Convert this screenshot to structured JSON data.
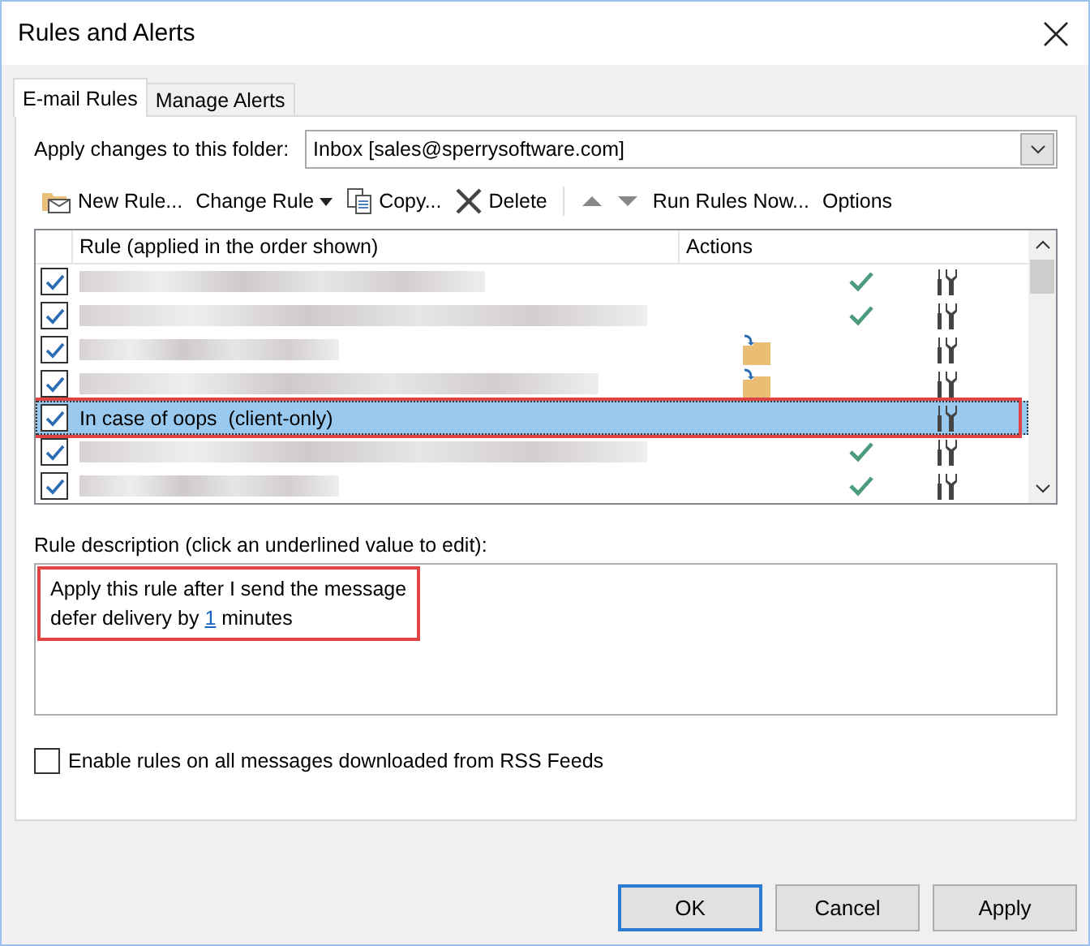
{
  "window": {
    "title": "Rules and Alerts"
  },
  "tabs": [
    {
      "label": "E-mail Rules",
      "selected": true
    },
    {
      "label": "Manage Alerts",
      "selected": false
    }
  ],
  "folder": {
    "label": "Apply changes to this folder:",
    "value": "Inbox [sales@sperrysoftware.com]"
  },
  "toolbar": [
    {
      "kind": "new",
      "label": "New Rule..."
    },
    {
      "kind": "change",
      "label": "Change Rule"
    },
    {
      "kind": "copy",
      "label": "Copy..."
    },
    {
      "kind": "delete",
      "label": "Delete"
    },
    {
      "kind": "up"
    },
    {
      "kind": "down"
    },
    {
      "kind": "run",
      "label": "Run Rules Now..."
    },
    {
      "kind": "options",
      "label": "Options"
    }
  ],
  "table": {
    "columns": [
      "Rule (applied in the order shown)",
      "Actions"
    ],
    "rows": [
      {
        "kind": "check",
        "checked": true,
        "selected": false
      },
      {
        "kind": "check",
        "checked": true,
        "selected": false
      },
      {
        "kind": "move",
        "checked": true,
        "selected": false
      },
      {
        "kind": "move",
        "checked": true,
        "selected": false
      },
      {
        "kind": "plain",
        "name": "In case of oops  (client-only)",
        "checked": true,
        "selected": true,
        "annotated": true
      },
      {
        "kind": "check",
        "checked": true,
        "selected": false
      },
      {
        "kind": "check",
        "checked": true,
        "selected": false
      }
    ]
  },
  "description": {
    "label": "Rule description (click an underlined value to edit):",
    "annotated": true,
    "lines": [
      {
        "text": "Apply this rule after I send the message"
      },
      {
        "text": "defer delivery by ",
        "link": "1",
        "after": " minutes"
      }
    ]
  },
  "rss": {
    "label": "Enable rules on all messages downloaded from RSS Feeds",
    "checked": false
  },
  "buttons": [
    {
      "label": "OK",
      "default": true
    },
    {
      "label": "Cancel",
      "default": false
    },
    {
      "label": "Apply",
      "default": false
    }
  ]
}
